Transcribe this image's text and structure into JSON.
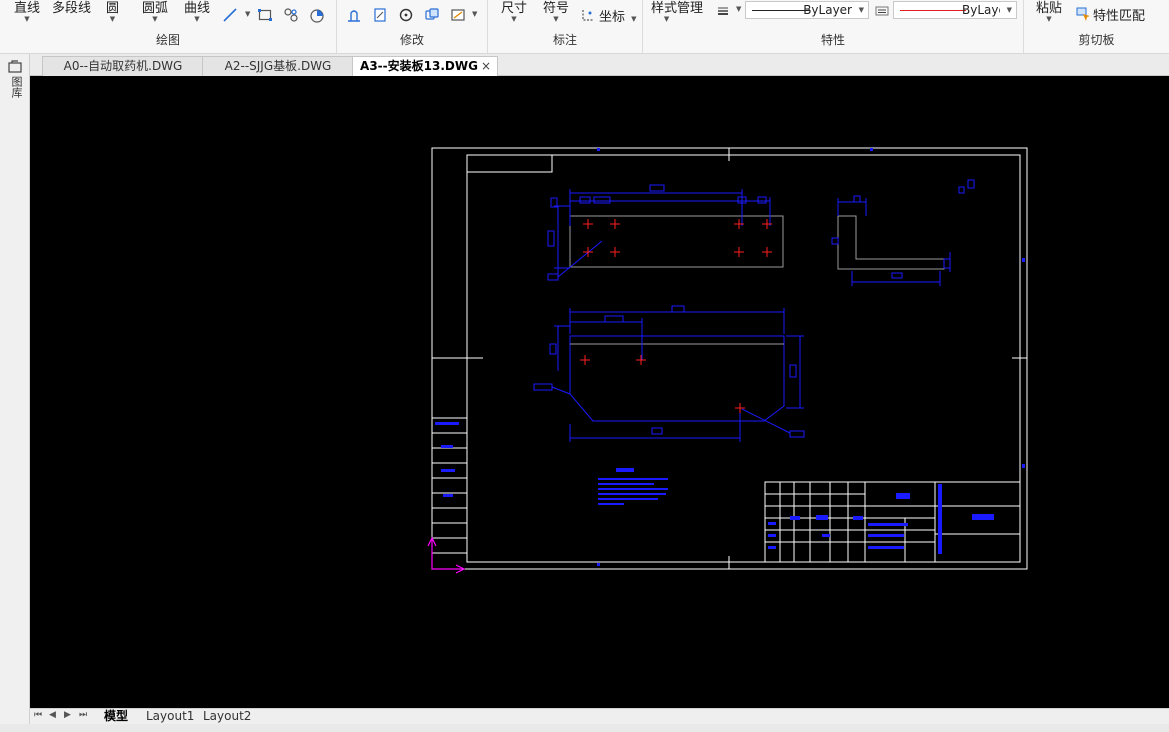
{
  "ribbon": {
    "draw": {
      "line": "直线",
      "polyline": "多段线",
      "circle": "圆",
      "arc": "圆弧",
      "curve": "曲线",
      "title": "绘图"
    },
    "modify": {
      "title": "修改"
    },
    "annotate": {
      "dimension": "尺寸",
      "symbol": "符号",
      "coordinate": "坐标",
      "title": "标注"
    },
    "properties": {
      "style_manager": "样式管理",
      "linetype": "ByLayer",
      "color": "ByLayer",
      "title": "特性"
    },
    "clipboard": {
      "paste": "粘贴",
      "match_properties": "特性匹配",
      "title": "剪切板"
    }
  },
  "tabs": [
    {
      "label": "A0--自动取药机.DWG",
      "active": false
    },
    {
      "label": "A2--SJJG基板.DWG",
      "active": false
    },
    {
      "label": "A3--安装板13.DWG",
      "active": true
    }
  ],
  "tab_close": "×",
  "left_dock": {
    "label": "图库"
  },
  "layout_tabs": [
    {
      "label": "模型",
      "active": true
    },
    {
      "label": "Layout1",
      "active": false
    },
    {
      "label": "Layout2",
      "active": false
    }
  ],
  "colors": {
    "drawing_bg": "#000000",
    "frame": "#ffffff",
    "dimension": "#1a1aff",
    "centermark": "#ff2020",
    "part": "#9a9a9a",
    "ucs": "#ff00ff",
    "layer_line_red": "#e02020"
  }
}
